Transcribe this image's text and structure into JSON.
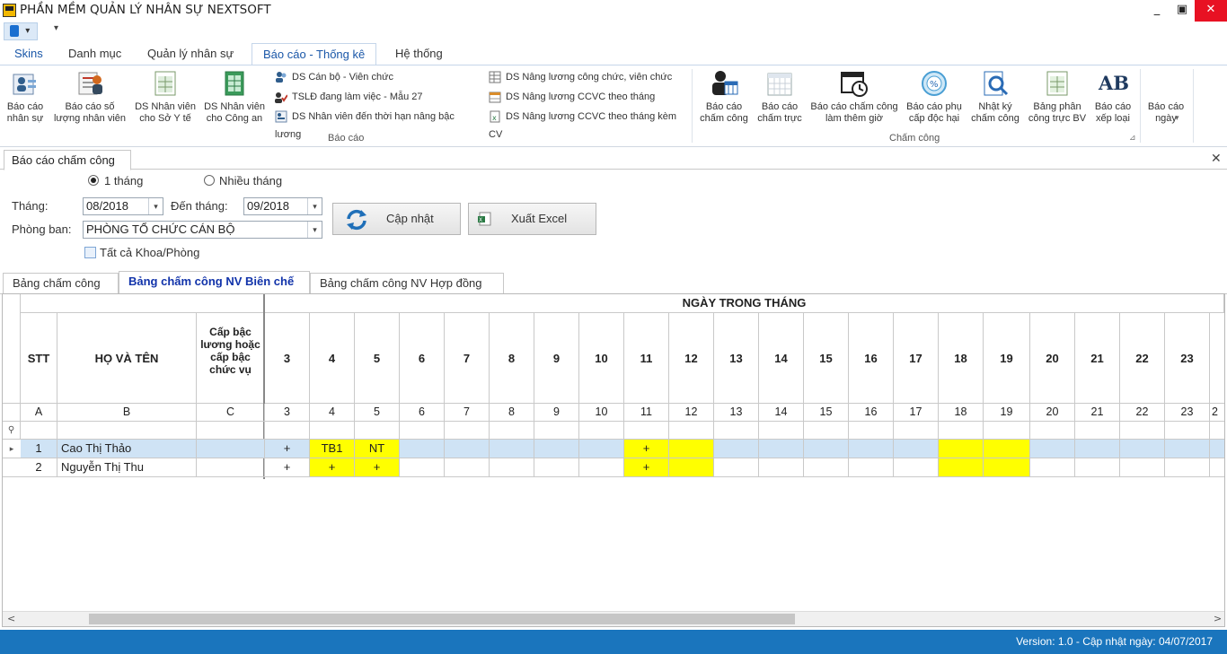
{
  "app": {
    "title": "PHẦN MỀM QUẢN LÝ NHÂN SỰ NEXTSOFT"
  },
  "window": {
    "minimize": "_",
    "maximize": "▣",
    "close": "✕"
  },
  "qat": {
    "menu_glyph": "▾"
  },
  "ribbon_tabs": [
    "Skins",
    "Danh mục",
    "Quản lý nhân sự",
    "Báo cáo - Thống kê",
    "Hệ thống"
  ],
  "ribbon": {
    "bao_cao_group": {
      "label": "Báo cáo",
      "large_buttons": [
        {
          "label1": "Báo cáo",
          "label2": "nhân sự",
          "icon": "people-report-icon"
        },
        {
          "label1": "Báo cáo số",
          "label2": "lượng nhân viên",
          "icon": "staff-count-icon"
        },
        {
          "label1": "DS Nhân viên",
          "label2": "cho Sở Y tế",
          "icon": "spreadsheet-icon"
        },
        {
          "label1": "DS Nhân viên",
          "label2": "cho Công an",
          "icon": "spreadsheet-green-icon"
        }
      ],
      "small_col1": [
        {
          "label": "DS Cán bộ - Viên chức",
          "icon": "users-icon"
        },
        {
          "label": "TSLĐ đang làm việc - Mẫu 27",
          "icon": "users-check-icon"
        },
        {
          "label": "DS Nhân viên đến thời hạn nâng bậc lương",
          "icon": "list-icon"
        }
      ],
      "small_col2": [
        {
          "label": "DS Nâng lương công chức, viên chức",
          "icon": "table-icon"
        },
        {
          "label": "DS Nâng lương CCVC theo tháng",
          "icon": "calendar-table-icon"
        },
        {
          "label": "DS Nâng lương CCVC theo tháng kèm CV",
          "icon": "excel-doc-icon"
        }
      ]
    },
    "cham_cong_group": {
      "label": "Chấm công",
      "buttons": [
        {
          "label1": "Báo cáo",
          "label2": "chấm công",
          "icon": "person-calendar-icon"
        },
        {
          "label1": "Báo cáo",
          "label2": "chấm trực",
          "icon": "calendar-grid-icon"
        },
        {
          "label1": "Báo cáo chấm công",
          "label2": "làm thêm giờ",
          "icon": "calendar-clock-icon"
        },
        {
          "label1": "Báo cáo phụ",
          "label2": "cấp độc hại",
          "icon": "percent-badge-icon"
        },
        {
          "label1": "Nhật ký",
          "label2": "chấm công",
          "icon": "magnifier-doc-icon"
        },
        {
          "label1": "Bảng phân",
          "label2": "công trực BV",
          "icon": "sheet-icon"
        },
        {
          "label1": "Báo cáo",
          "label2": "xếp loại",
          "icon": "ab-icon"
        }
      ]
    },
    "bao_cao_ngay": {
      "label1": "Báo cáo",
      "label2": "ngày",
      "arrow": "▾"
    }
  },
  "doc_tab": {
    "title": "Báo cáo chấm công",
    "close": "✕"
  },
  "filters": {
    "radio_one_month": "1 tháng",
    "radio_multi_month": "Nhiều tháng",
    "month_label": "Tháng:",
    "month_value": "08/2018",
    "to_month_label": "Đến tháng:",
    "to_month_value": "09/2018",
    "dept_label": "Phòng ban:",
    "dept_value": "PHÒNG TỔ CHỨC CÁN BỘ",
    "all_dept_label": "Tất cả Khoa/Phòng",
    "update_button": "Cập nhật",
    "export_button": "Xuất Excel",
    "dropdown_glyph": "▾"
  },
  "inner_tabs": [
    "Bảng chấm công",
    "Bảng chấm công NV Biên chế",
    "Bảng chấm công NV Hợp đồng"
  ],
  "grid": {
    "band_title": "NGÀY TRONG THÁNG",
    "col_stt": "STT",
    "col_name": "HỌ VÀ TÊN",
    "col_rank": "Cấp bậc lương hoặc cấp bậc chức vụ",
    "letters": [
      "A",
      "B",
      "C"
    ],
    "days": [
      "3",
      "4",
      "5",
      "6",
      "7",
      "8",
      "9",
      "10",
      "11",
      "12",
      "13",
      "14",
      "15",
      "16",
      "17",
      "18",
      "19",
      "20",
      "21",
      "22",
      "23"
    ],
    "partial_day_letter": "2",
    "filter_row_icon": "⚲",
    "scroll_left": "<",
    "scroll_right": ">",
    "rows": [
      {
        "stt": "1",
        "name": "Cao Thị Thảo",
        "rank": "",
        "indicator": "▸",
        "cells": [
          "+",
          "TB1",
          "NT",
          "",
          "",
          "",
          "",
          "",
          "+",
          "",
          "",
          "",
          "",
          "",
          "",
          "",
          "",
          "",
          "",
          "",
          ""
        ],
        "yellow": [
          false,
          true,
          true,
          false,
          false,
          false,
          false,
          false,
          true,
          true,
          false,
          false,
          false,
          false,
          false,
          true,
          true,
          false,
          false,
          false,
          false
        ]
      },
      {
        "stt": "2",
        "name": "Nguyễn Thị Thu",
        "rank": "",
        "indicator": "",
        "cells": [
          "+",
          "+",
          "+",
          "",
          "",
          "",
          "",
          "",
          "+",
          "",
          "",
          "",
          "",
          "",
          "",
          "",
          "",
          "",
          "",
          "",
          ""
        ],
        "yellow": [
          false,
          true,
          true,
          false,
          false,
          false,
          false,
          false,
          true,
          true,
          false,
          false,
          false,
          false,
          false,
          true,
          true,
          false,
          false,
          false,
          false
        ]
      }
    ]
  },
  "status": {
    "version": "Version: 1.0 - Cập nhật ngày: 04/07/2017"
  },
  "colors": {
    "accent": "#1a75bd",
    "highlight": "#ffff00",
    "selected_row": "#cfe3f5"
  }
}
